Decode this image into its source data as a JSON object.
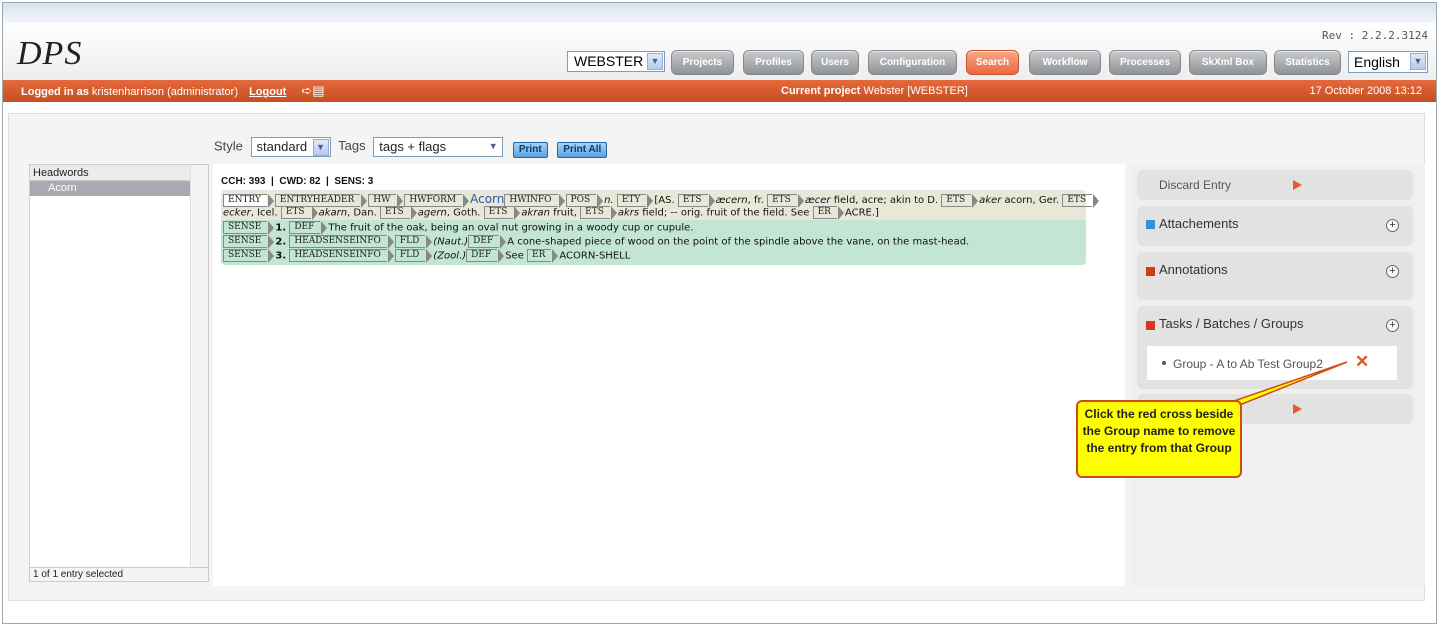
{
  "app": {
    "logo": "DPS",
    "rev": "Rev : 2.2.2.3124"
  },
  "header": {
    "project_select": "WEBSTER",
    "nav": [
      "Projects",
      "Profiles",
      "Users",
      "Configuration",
      "Search",
      "Workflow",
      "Processes",
      "SkXml Box",
      "Statistics"
    ],
    "active_nav": "Search",
    "language": "English"
  },
  "statusbar": {
    "logged_in_label": "Logged in as",
    "user": "kristenharrison (administrator)",
    "logout": "Logout",
    "current_project_label": "Current project",
    "current_project": "Webster [WEBSTER]",
    "datetime": "17 October 2008 13:12"
  },
  "toolbar": {
    "style_label": "Style",
    "style_value": "standard",
    "tags_label": "Tags",
    "tags_value": "tags + flags",
    "print": "Print",
    "print_all": "Print All"
  },
  "headwords": {
    "header": "Headwords",
    "items": [
      "Acorn"
    ],
    "footer": "1 of 1 entry selected"
  },
  "entry": {
    "counts": "CCH: 393  |  CWD: 82  |  SENS: 3",
    "tags": {
      "entry": "ENTRY",
      "entryheader": "ENTRYHEADER",
      "hw": "HW",
      "hwform": "HWFORM",
      "hwinfo": "HWINFO",
      "pos": "POS",
      "ety": "ETY",
      "ets": "ETS",
      "er": "ER",
      "sense": "SENSE",
      "def": "DEF",
      "headsenseinfo": "HEADSENSEINFO",
      "fld": "FLD"
    },
    "headword": "Acorn",
    "pos": "n.",
    "ety_text": {
      "as": "[AS.",
      "aecern": "æcern",
      "fr": ", fr.",
      "aecer": "æcer",
      "field_acre": " field, acre; akin to D.",
      "aker": "aker",
      "acorn_ger": " acorn, Ger.",
      "ecker": "ecker",
      "icel": ", Icel.",
      "akarn": "akarn",
      "dan": ", Dan.",
      "agern": "agern",
      "goth": ", Goth.",
      "akran": "akran",
      "fruit": " fruit,",
      "akrs": "akrs",
      "field_orig": " field; -- orig. fruit of the field. See",
      "acre": "ACRE.]"
    },
    "senses": [
      {
        "num": "1.",
        "def": "The fruit of the oak, being an oval nut growing in a woody cup or cupule."
      },
      {
        "num": "2.",
        "fld": "(Naut.)",
        "def": "A cone-shaped piece of wood on the point of the spindle above the vane, on the mast-head."
      },
      {
        "num": "3.",
        "fld": "(Zool.)",
        "def_see": "See",
        "er": "ACORN-SHELL"
      }
    ]
  },
  "sidebar": {
    "discard": "Discard Entry",
    "attachements": "Attachements",
    "annotations": "Annotations",
    "tasks": "Tasks / Batches / Groups",
    "group_item": "Group - A to Ab Test Group2",
    "colors": {
      "attach": "#3a8fd1",
      "annot": "#d33a1a",
      "tasks": "#d33a1a"
    }
  },
  "callout": {
    "text": "Click the red cross beside the Group name to remove the entry from that Group"
  }
}
